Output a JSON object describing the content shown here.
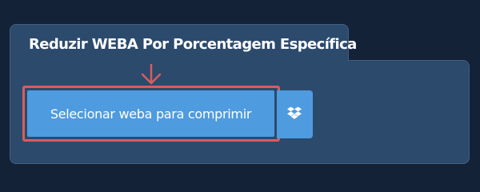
{
  "panel": {
    "title": "Reduzir WEBA Por Porcentagem Específica"
  },
  "upload": {
    "select_label": "Selecionar weba para comprimir",
    "dropbox_icon": "dropbox-icon"
  },
  "colors": {
    "background": "#132237",
    "panel": "#2c4a6c",
    "button": "#4e9be0",
    "highlight": "#d95c5f"
  }
}
